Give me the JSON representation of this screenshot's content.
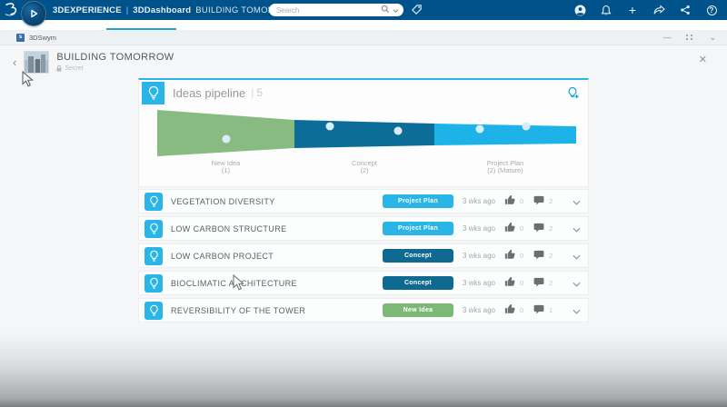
{
  "colors": {
    "brand_navy": "#00538a",
    "accent_cyan": "#29b5e8",
    "stage_green": "#88bb81",
    "stage_teal": "#0d6d99",
    "stage_cyan": "#1db2e8",
    "status_colors": {
      "Project Plan": "#29b5e8",
      "Concept": "#0f6a92",
      "New Idea": "#7cb977"
    }
  },
  "topbar": {
    "brand": "3DEXPERIENCE",
    "divider": "|",
    "app": "3DDashboard",
    "context": "BUILDING TOMORROW",
    "context_chevron": "˅",
    "search_placeholder": "Search",
    "plus": "+",
    "help": "?"
  },
  "tabs": {
    "active_indicator": true
  },
  "swym_bar": {
    "app_label": "3DSwym",
    "minimize": "—",
    "chevron": "⌄"
  },
  "community": {
    "back": "‹",
    "title": "BUILDING TOMORROW",
    "privacy": "Secret",
    "close": "✕"
  },
  "pipeline": {
    "title": "Ideas pipeline",
    "separator": "|",
    "count": "5"
  },
  "chart_data": {
    "type": "funnel",
    "title": "Ideas pipeline",
    "total": 5,
    "legend_position": "below-stages",
    "stages": [
      {
        "label": "New Idea",
        "count_label": "(1)",
        "count": 1,
        "color": "#88bb81",
        "dots": 1
      },
      {
        "label": "Concept",
        "count_label": "(2)",
        "count": 2,
        "color": "#0d6d99",
        "dots": 2
      },
      {
        "label": "Project Plan",
        "count_label": "(2) (Mature)",
        "count": 2,
        "color": "#1db2e8",
        "dots": 2
      }
    ]
  },
  "ideas": [
    {
      "title": "VEGETATION DIVERSITY",
      "status": "Project Plan",
      "age": "3 wks ago",
      "likes": "0",
      "comments": "2"
    },
    {
      "title": "LOW CARBON STRUCTURE",
      "status": "Project Plan",
      "age": "3 wks ago",
      "likes": "0",
      "comments": "2"
    },
    {
      "title": "LOW CARBON PROJECT",
      "status": "Concept",
      "age": "3 wks ago",
      "likes": "0",
      "comments": "2"
    },
    {
      "title": "BIOCLIMATIC ARCHITECTURE",
      "status": "Concept",
      "age": "3 wks ago",
      "likes": "0",
      "comments": "2"
    },
    {
      "title": "REVERSIBILITY OF THE TOWER",
      "status": "New Idea",
      "age": "3 wks ago",
      "likes": "0",
      "comments": "1"
    }
  ]
}
